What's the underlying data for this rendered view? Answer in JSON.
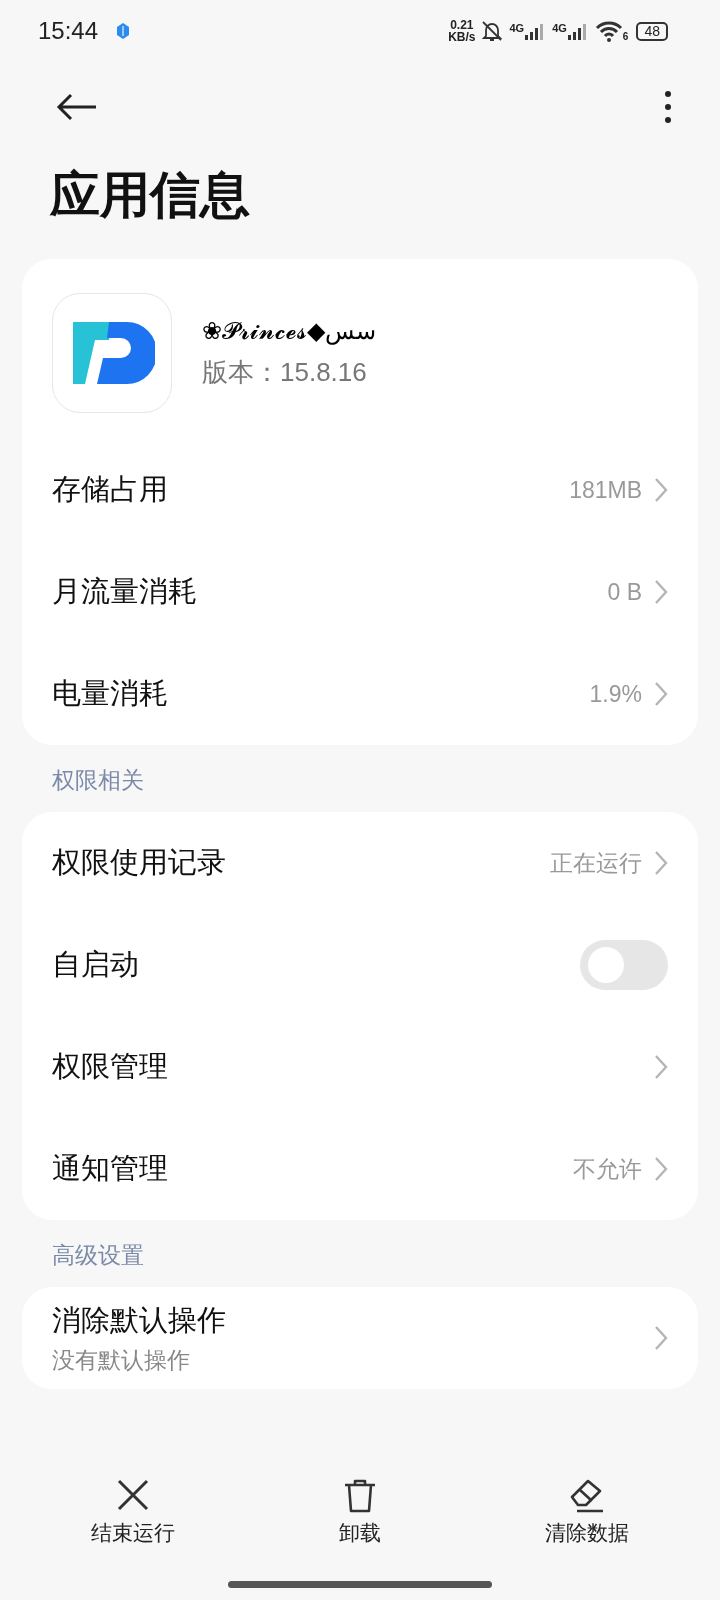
{
  "status_bar": {
    "time": "15:44",
    "speed_value": "0.21",
    "speed_unit": "KB/s",
    "sim_labels": [
      "4G",
      "4G"
    ],
    "wifi_label": "6",
    "battery": "48"
  },
  "header": {
    "title": "应用信息"
  },
  "app": {
    "name": "❀𝓟𝓻𝓲𝓷𝓬𝓮𝓼◆سس",
    "version": "版本：15.8.16"
  },
  "sections": [
    {
      "rows": [
        {
          "kind": "link",
          "label": "存储占用",
          "value": "181MB"
        },
        {
          "kind": "link",
          "label": "月流量消耗",
          "value": "0 B"
        },
        {
          "kind": "link",
          "label": "电量消耗",
          "value": "1.9%"
        }
      ]
    },
    {
      "title": "权限相关",
      "rows": [
        {
          "kind": "link",
          "label": "权限使用记录",
          "value": "正在运行"
        },
        {
          "kind": "toggle",
          "label": "自启动",
          "on": false
        },
        {
          "kind": "link",
          "label": "权限管理"
        },
        {
          "kind": "link",
          "label": "通知管理",
          "value": "不允许"
        }
      ]
    },
    {
      "title": "高级设置",
      "rows": [
        {
          "kind": "link",
          "label": "消除默认操作",
          "subtitle": "没有默认操作"
        }
      ]
    }
  ],
  "actions": [
    {
      "kind": "close",
      "label": "结束运行"
    },
    {
      "kind": "trash",
      "label": "卸载"
    },
    {
      "kind": "eraser",
      "label": "清除数据"
    }
  ]
}
